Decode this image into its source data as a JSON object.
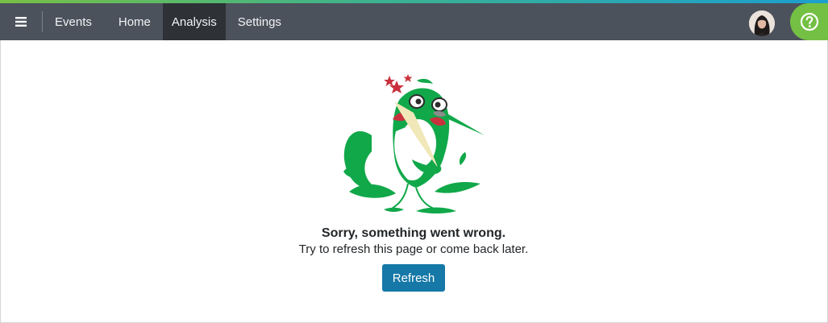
{
  "colors": {
    "navbar": "#4c525c",
    "active_tab": "#2e3237",
    "help_button": "#74c044",
    "primary_button": "#1578a7",
    "bird_green": "#11a84a",
    "beak": "#f0e8b8",
    "stars": "#c8313d"
  },
  "navbar": {
    "menu_icon": "hamburger-icon",
    "tabs": [
      {
        "label": "Events",
        "active": false
      },
      {
        "label": "Home",
        "active": false
      },
      {
        "label": "Analysis",
        "active": true
      },
      {
        "label": "Settings",
        "active": false
      }
    ],
    "avatar_icon": "user-avatar",
    "help_icon": "question-mark-icon"
  },
  "error": {
    "illustration": "dizzy-hummingbird-illustration",
    "title": "Sorry, something went wrong.",
    "message": "Try to refresh this page or come back later.",
    "refresh_label": "Refresh"
  }
}
